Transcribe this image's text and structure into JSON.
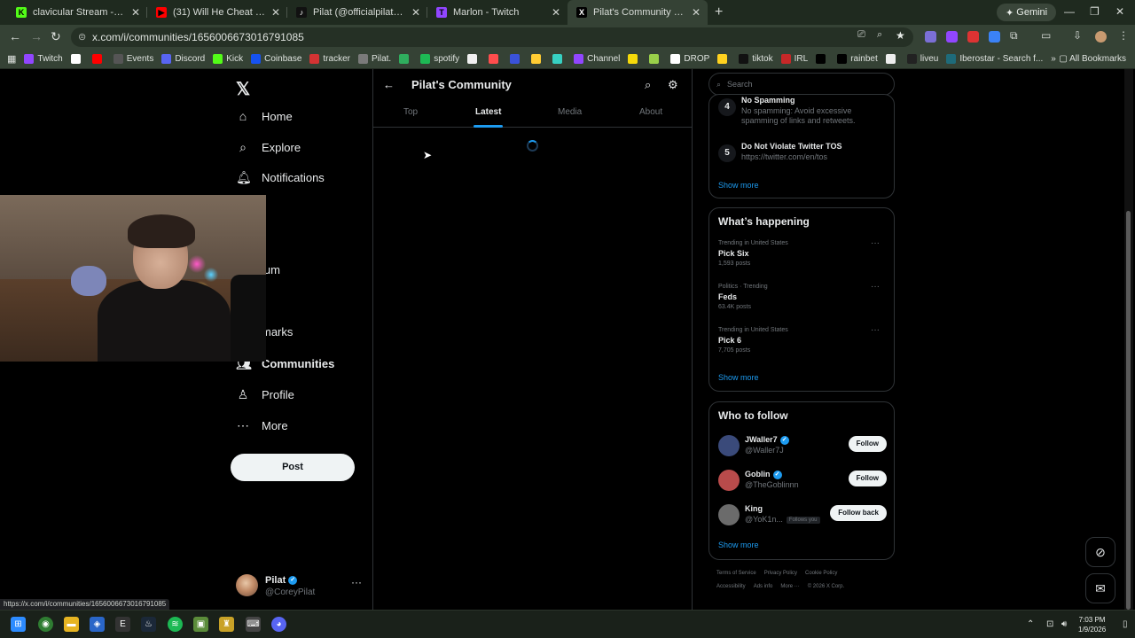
{
  "browser": {
    "tabs": [
      {
        "title": "clavicular Stream - Watch Live",
        "favicon_color": "#53fc18",
        "favicon_glyph": "K"
      },
      {
        "title": "(31) Will He Cheat With The Gi",
        "favicon_color": "#ff0000",
        "favicon_glyph": "▶"
      },
      {
        "title": "Pilat (@officialpilat) | TikTok",
        "favicon_color": "#111111",
        "favicon_glyph": "♪"
      },
      {
        "title": "Marlon - Twitch",
        "favicon_color": "#9146ff",
        "favicon_glyph": "T"
      },
      {
        "title": "Pilat's Community Community",
        "favicon_color": "#000000",
        "favicon_glyph": "X",
        "active": true
      }
    ],
    "new_tab_label": "+",
    "gemini_label": "Gemini",
    "url": "x.com/i/communities/1656006673016791085",
    "bookmarks": [
      {
        "label": "Twitch",
        "color": "#9146ff"
      },
      {
        "label": "",
        "color": "#ffffff"
      },
      {
        "label": "",
        "color": "#ff0000"
      },
      {
        "label": "Events",
        "color": "#555555"
      },
      {
        "label": "Discord",
        "color": "#5865f2"
      },
      {
        "label": "Kick",
        "color": "#53fc18"
      },
      {
        "label": "Coinbase",
        "color": "#1652f0"
      },
      {
        "label": "tracker",
        "color": "#d33333"
      },
      {
        "label": "Pilat.",
        "color": "#7a7a7a"
      },
      {
        "label": "",
        "color": "#2fae5e"
      },
      {
        "label": "spotify",
        "color": "#1db954"
      },
      {
        "label": "",
        "color": "#f0f0f0"
      },
      {
        "label": "",
        "color": "#ff4d4d"
      },
      {
        "label": "",
        "color": "#3a52d9"
      },
      {
        "label": "",
        "color": "#ffcc33"
      },
      {
        "label": "",
        "color": "#37d0c2"
      },
      {
        "label": "Channel",
        "color": "#9146ff"
      },
      {
        "label": "",
        "color": "#f5d90a"
      },
      {
        "label": "",
        "color": "#9ad04a"
      },
      {
        "label": "DROP",
        "color": "#ffffff"
      },
      {
        "label": "",
        "color": "#ffd21f"
      },
      {
        "label": "tiktok",
        "color": "#111111"
      },
      {
        "label": "IRL",
        "color": "#c62828"
      },
      {
        "label": "",
        "color": "#000000"
      },
      {
        "label": "rainbet",
        "color": "#000000"
      },
      {
        "label": "",
        "color": "#eeeeee"
      },
      {
        "label": "liveu",
        "color": "#222222"
      },
      {
        "label": "Iberostar - Search f...",
        "color": "#1e6b7a"
      }
    ],
    "all_bookmarks_label": "All Bookmarks",
    "status_url": "https://x.com/i/communities/1656006673016791085"
  },
  "leftnav": {
    "items": [
      {
        "label": "Home",
        "icon": "⌂",
        "icon_name": "home-icon"
      },
      {
        "label": "Explore",
        "icon": "⌕",
        "icon_name": "search-icon"
      },
      {
        "label": "Notifications",
        "icon": "🔔︎",
        "icon_name": "bell-icon"
      },
      {
        "label": "ium",
        "icon": "",
        "icon_name": "premium-icon"
      },
      {
        "label": "marks",
        "icon": "",
        "icon_name": "bookmark-icon"
      },
      {
        "label": "Communities",
        "icon": "👥︎",
        "icon_name": "communities-icon",
        "bold": true
      },
      {
        "label": "Profile",
        "icon": "♙",
        "icon_name": "profile-icon"
      },
      {
        "label": "More",
        "icon": "⋯",
        "icon_name": "more-icon"
      }
    ],
    "post_label": "Post",
    "user": {
      "name": "Pilat",
      "handle": "@CoreyPilat"
    }
  },
  "community": {
    "title": "Pilat's Community",
    "tabs": [
      "Top",
      "Latest",
      "Media",
      "About"
    ],
    "selected_tab": "Latest"
  },
  "sidebar": {
    "search_placeholder": "Search",
    "rules": [
      {
        "num": "4",
        "title": "No Spamming",
        "desc": "No spamming: Avoid excessive spamming of links and retweets."
      },
      {
        "num": "5",
        "title": "Do Not Violate Twitter TOS",
        "desc": "https://twitter.com/en/tos"
      }
    ],
    "rules_show_more": "Show more",
    "whats_happening": {
      "title": "What’s happening",
      "trends": [
        {
          "context": "Trending in United States",
          "name": "Pick Six",
          "posts": "1,593 posts"
        },
        {
          "context": "Politics · Trending",
          "name": "Feds",
          "posts": "63.4K posts"
        },
        {
          "context": "Trending in United States",
          "name": "Pick 6",
          "posts": "7,705 posts"
        }
      ],
      "show_more": "Show more"
    },
    "who_to_follow": {
      "title": "Who to follow",
      "accounts": [
        {
          "name": "JWaller7",
          "handle": "@Waller7J",
          "button": "Follow",
          "verified": true,
          "follows_you": "",
          "avatar_color": "#3a4a7a"
        },
        {
          "name": "Goblin",
          "handle": "@TheGoblinnn",
          "button": "Follow",
          "verified": true,
          "follows_you": "",
          "avatar_color": "#b94b4b"
        },
        {
          "name": "King",
          "handle": "@YoK1n...",
          "button": "Follow back",
          "verified": false,
          "follows_you": "Follows you",
          "avatar_color": "#6b6b6b"
        }
      ],
      "show_more": "Show more"
    },
    "footer": {
      "line1": [
        "Terms of Service",
        "Privacy Policy",
        "Cookie Policy"
      ],
      "line2": [
        "Accessibility",
        "Ads info",
        "More ···",
        "© 2026 X Corp."
      ]
    }
  },
  "taskbar": {
    "time": "7:03 PM",
    "date": "1/9/2026"
  }
}
